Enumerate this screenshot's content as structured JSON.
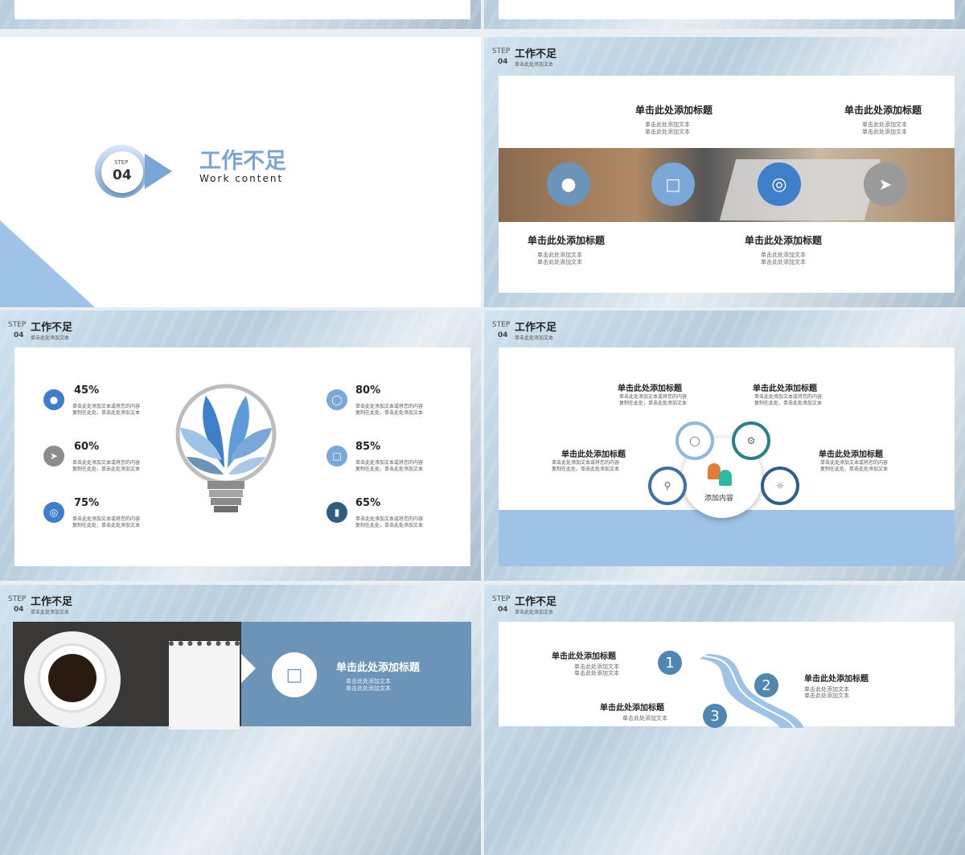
{
  "header": {
    "step": "STEP",
    "num": "04",
    "title": "工作不足",
    "subtitle": "单击此处添加文本"
  },
  "cover": {
    "step": "STEP",
    "num": "04",
    "title": "工作不足",
    "subtitle": "Work content"
  },
  "slide_icons": {
    "top_items": [
      {
        "title": "单击此处添加标题",
        "l1": "单击此处添加文本",
        "l2": "单击此处添加文本"
      },
      {
        "title": "单击此处添加标题",
        "l1": "单击此处添加文本",
        "l2": "单击此处添加文本"
      }
    ],
    "bottom_items": [
      {
        "title": "单击此处添加标题",
        "l1": "单击此处添加文本",
        "l2": "单击此处添加文本"
      },
      {
        "title": "单击此处添加标题",
        "l1": "单击此处添加文本",
        "l2": "单击此处添加文本"
      }
    ],
    "icons": [
      "user-icon",
      "chat-icon",
      "globe-icon",
      "paper-plane-icon"
    ]
  },
  "slide_bulb": {
    "items": [
      {
        "pct": "45%",
        "l1": "单击此处添加文本或将您的内容",
        "l2": "复制在此处，单击此处添加文本"
      },
      {
        "pct": "60%",
        "l1": "单击此处添加文本或将您的内容",
        "l2": "复制在此处，单击此处添加文本"
      },
      {
        "pct": "75%",
        "l1": "单击此处添加文本或将您的内容",
        "l2": "复制在此处，单击此处添加文本"
      },
      {
        "pct": "80%",
        "l1": "单击此处添加文本或将您的内容",
        "l2": "复制在此处，单击此处添加文本"
      },
      {
        "pct": "85%",
        "l1": "单击此处添加文本或将您的内容",
        "l2": "复制在此处，单击此处添加文本"
      },
      {
        "pct": "65%",
        "l1": "单击此处添加文本或将您的内容",
        "l2": "复制在此处，单击此处添加文本"
      }
    ],
    "colors": {
      "blue": "#3f7fc9",
      "gray": "#8c8c8c",
      "light": "#7aa9d9",
      "dark": "#2e5e82"
    }
  },
  "slide_cycle": {
    "center": "添加内容",
    "items": [
      {
        "title": "单击此处添加标题",
        "l1": "单击此处添加文本或将您的内容",
        "l2": "复制在此处，单击此处添加文本"
      },
      {
        "title": "单击此处添加标题",
        "l1": "单击此处添加文本或将您的内容",
        "l2": "复制在此处，单击此处添加文本"
      },
      {
        "title": "单击此处添加标题",
        "l1": "单击此处添加文本或将您的内容",
        "l2": "复制在此处，单击此处添加文本"
      },
      {
        "title": "单击此处添加标题",
        "l1": "单击此处添加文本或将您的内容",
        "l2": "复制在此处，单击此处添加文本"
      }
    ]
  },
  "slide_coffee": {
    "title": "单击此处添加标题",
    "l1": "单击此处添加文本",
    "l2": "单击此处添加文本"
  },
  "slide_road": {
    "items": [
      {
        "n": "1",
        "title": "单击此处添加标题",
        "l1": "单击此处添加文本",
        "l2": "单击此处添加文本"
      },
      {
        "n": "2",
        "title": "单击此处添加标题",
        "l1": "单击此处添加文本",
        "l2": "单击此处添加文本"
      },
      {
        "n": "3",
        "title": "单击此处添加标题",
        "l1": "单击此处添加文本"
      }
    ]
  },
  "colors": {
    "accent": "#7aa6d6",
    "band": "#9fc3e7",
    "panel": "#6c93b8"
  }
}
